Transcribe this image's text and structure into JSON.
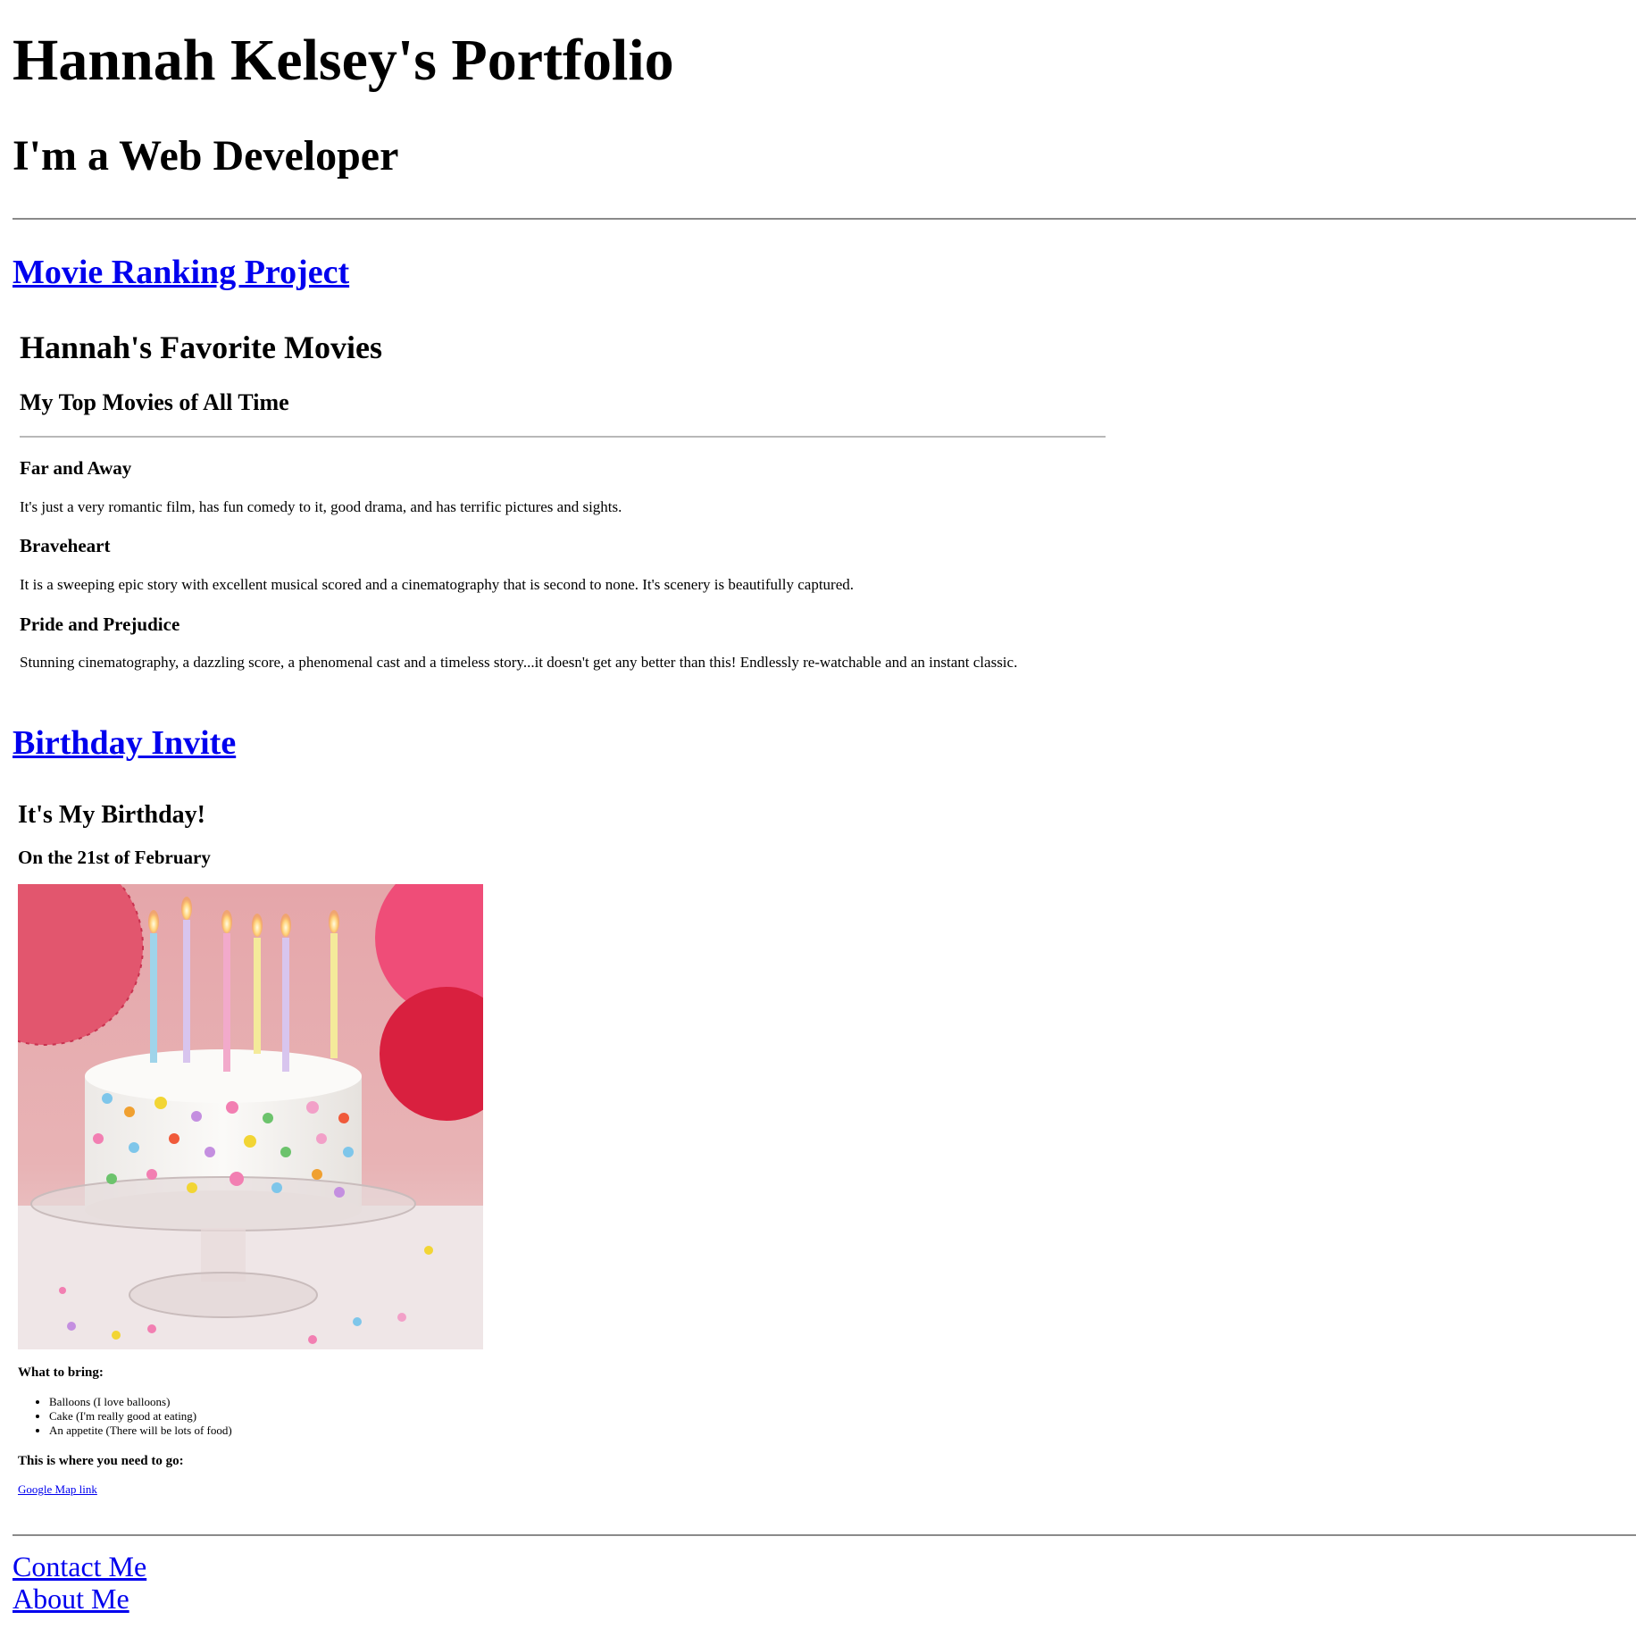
{
  "header": {
    "title": "Hannah Kelsey's Portfolio",
    "subtitle": "I'm a Web Developer"
  },
  "projects": {
    "movie_link": "Movie Ranking Project",
    "birthday_link": "Birthday Invite"
  },
  "movies": {
    "title": "Hannah's Favorite Movies",
    "subtitle": "My Top Movies of All Time",
    "items": [
      {
        "name": "Far and Away",
        "description": "It's just a very romantic film, has fun comedy to it, good drama, and has terrific pictures and sights."
      },
      {
        "name": "Braveheart",
        "description": "It is a sweeping epic story with excellent musical scored and a cinematography that is second to none. It's scenery is beautifully captured."
      },
      {
        "name": "Pride and Prejudice",
        "description": "Stunning cinematography, a dazzling score, a phenomenal cast and a timeless story...it doesn't get any better than this! Endlessly re-watchable and an instant classic."
      }
    ]
  },
  "birthday": {
    "title": "It's My Birthday!",
    "date": "On the 21st of February",
    "bring_label": "What to bring:",
    "bring_items": [
      "Balloons (I love balloons)",
      "Cake (I'm really good at eating)",
      "An appetite (There will be lots of food)"
    ],
    "go_label": "This is where you need to go:",
    "map_link": "Google Map link"
  },
  "footer": {
    "contact": "Contact Me",
    "about": "About Me"
  },
  "colors": {
    "link": "#0000ee",
    "rule": "#8a8a8a"
  }
}
